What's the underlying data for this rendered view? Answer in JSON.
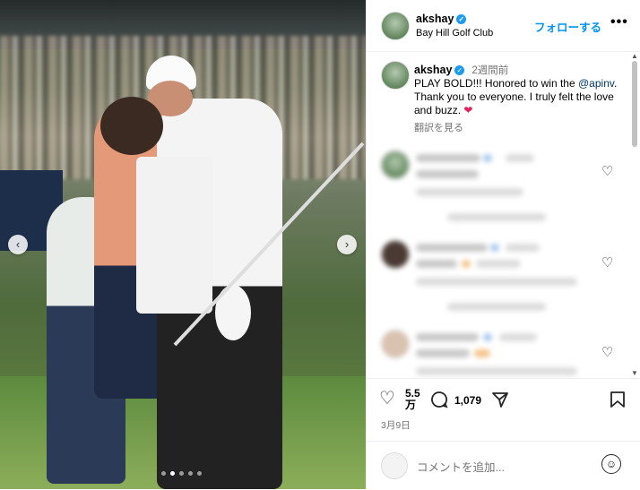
{
  "post": {
    "username": "akshay",
    "location": "Bay Hill Golf Club",
    "follow_label": "フォローする",
    "more_label": "•••",
    "verified_icon": "verified-badge-icon"
  },
  "photo": {
    "prev_icon": "‹",
    "next_icon": "›",
    "slide_count": 5,
    "active_slide": 2
  },
  "caption": {
    "username": "akshay",
    "time_ago": "2週間前",
    "text_before": "PLAY BOLD!!! Honored to win the ",
    "mention": "@apinv",
    "text_after": ". Thank you to everyone. I truly felt the love and buzz.",
    "emoji": "❤",
    "translate_label": "翻訳を見る"
  },
  "actions": {
    "likes": "5.5",
    "likes_unit": "万",
    "comments": "1,079",
    "date": "3月9日"
  },
  "composer": {
    "placeholder": "コメントを追加..."
  },
  "colors": {
    "accent": "#0095f6",
    "verified": "#1d9bf0",
    "heart": "#e0245e"
  }
}
